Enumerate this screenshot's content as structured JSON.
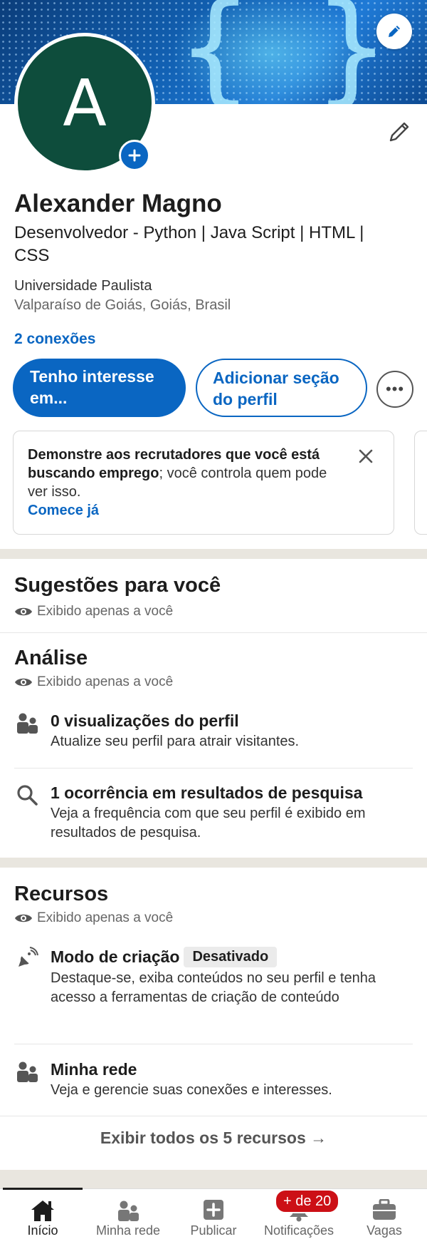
{
  "profile": {
    "avatar_initial": "A",
    "name": "Alexander Magno",
    "headline": "Desenvolvedor - Python | Java Script | HTML | CSS",
    "school": "Universidade Paulista",
    "location": "Valparaíso de Goiás, Goiás, Brasil",
    "connections": "2 conexões"
  },
  "actions": {
    "interest_label": "Tenho interesse em...",
    "add_section_label": "Adicionar seção do perfil",
    "more_label": "•••"
  },
  "promo": {
    "bold_text": "Demonstre aos recrutadores que você está buscando emprego",
    "text": "; você controla quem pode ver isso.",
    "link": "Comece já"
  },
  "suggestions": {
    "title": "Sugestões para você",
    "private_note": "Exibido apenas a você"
  },
  "analytics": {
    "title": "Análise",
    "private_note": "Exibido apenas a você",
    "items": [
      {
        "title": "0 visualizações do perfil",
        "desc": "Atualize seu perfil para atrair visitantes.",
        "icon": "people-icon"
      },
      {
        "title": "1 ocorrência em resultados de pesquisa",
        "desc": "Veja a frequência com que seu perfil é exibido em resultados de pesquisa.",
        "icon": "search-icon"
      }
    ]
  },
  "resources": {
    "title": "Recursos",
    "private_note": "Exibido apenas a você",
    "items": [
      {
        "title": "Modo de criação",
        "badge": "Desativado",
        "desc": "Destaque-se, exiba conteúdos no seu perfil e tenha acesso a ferramentas de criação de conteúdo",
        "icon": "satellite-dish-icon"
      },
      {
        "title": "Minha rede",
        "desc": "Veja e gerencie suas conexões e interesses.",
        "icon": "people-icon"
      }
    ],
    "show_all": "Exibir todos os 5 recursos →"
  },
  "nav": {
    "items": [
      {
        "label": "Início",
        "icon": "home-icon"
      },
      {
        "label": "Minha rede",
        "icon": "people-icon"
      },
      {
        "label": "Publicar",
        "icon": "plus-square-icon"
      },
      {
        "label": "Notificações",
        "icon": "bell-icon"
      },
      {
        "label": "Vagas",
        "icon": "briefcase-icon"
      }
    ],
    "notifications_badge": "+ de 20"
  },
  "colors": {
    "brand_blue": "#0a66c2",
    "avatar_green": "#0e4d3c",
    "badge_red": "#cc1016",
    "separator": "#e9e6df"
  }
}
